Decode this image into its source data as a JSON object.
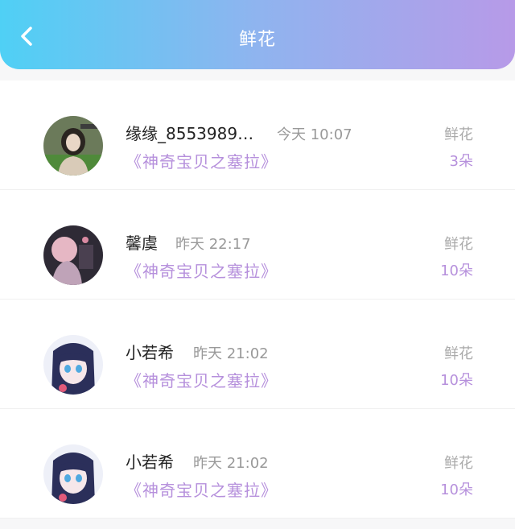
{
  "header": {
    "title": "鲜花",
    "back_icon": "chevron-left-icon"
  },
  "colors": {
    "accent": "#b690dc",
    "header_start": "#4fd0f5",
    "header_end": "#b79ae8"
  },
  "records": [
    {
      "name": "缘缘_8553989…",
      "time": "今天 10:07",
      "book": "《神奇宝贝之塞拉》",
      "gift": "鲜花",
      "count": "3朵",
      "avatar": "avatar-photo"
    },
    {
      "name": "馨虞",
      "time": "昨天 22:17",
      "book": "《神奇宝贝之塞拉》",
      "gift": "鲜花",
      "count": "10朵",
      "avatar": "avatar-anime"
    },
    {
      "name": "小若希",
      "time": "昨天 21:02",
      "book": "《神奇宝贝之塞拉》",
      "gift": "鲜花",
      "count": "10朵",
      "avatar": "avatar-anime"
    },
    {
      "name": "小若希",
      "time": "昨天 21:02",
      "book": "《神奇宝贝之塞拉》",
      "gift": "鲜花",
      "count": "10朵",
      "avatar": "avatar-anime"
    }
  ]
}
